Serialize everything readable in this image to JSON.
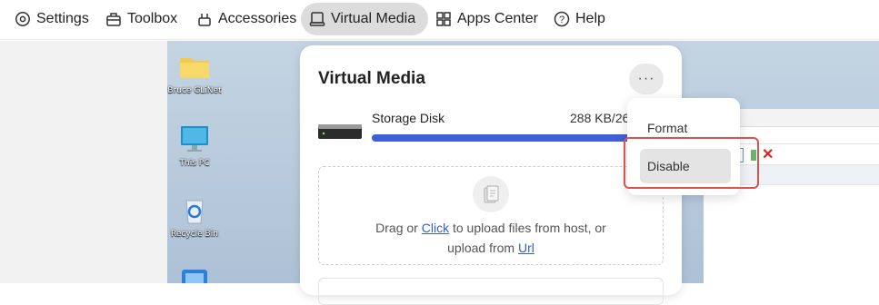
{
  "nav": {
    "items": [
      {
        "label": "Settings",
        "icon": "gear-icon"
      },
      {
        "label": "Toolbox",
        "icon": "toolbox-icon"
      },
      {
        "label": "Accessories",
        "icon": "accessories-icon"
      },
      {
        "label": "Virtual Media",
        "icon": "disk-icon",
        "active": true
      },
      {
        "label": "Apps Center",
        "icon": "apps-grid-icon"
      },
      {
        "label": "Help",
        "icon": "help-icon"
      }
    ]
  },
  "desktop": {
    "icons": [
      {
        "label": "Bruce GLiNet",
        "icon": "folder-icon"
      },
      {
        "label": "This PC",
        "icon": "monitor-icon"
      },
      {
        "label": "Recycle Bin",
        "icon": "recycle-bin-icon"
      }
    ]
  },
  "virtual_media": {
    "title": "Virtual Media",
    "more_label": "···",
    "disk": {
      "name": "Storage Disk",
      "size_text": "288 KB/26.",
      "used_fraction": 0.99
    },
    "drop": {
      "text_before_click": "Drag or ",
      "click_label": "Click",
      "text_after_click": " to upload files from host, or",
      "text_before_url": "upload from ",
      "url_label": "Url"
    }
  },
  "menu": {
    "format_label": "Format",
    "disable_label": "Disable"
  },
  "colors": {
    "accent": "#3d5fd8",
    "highlight": "#d9534f"
  }
}
